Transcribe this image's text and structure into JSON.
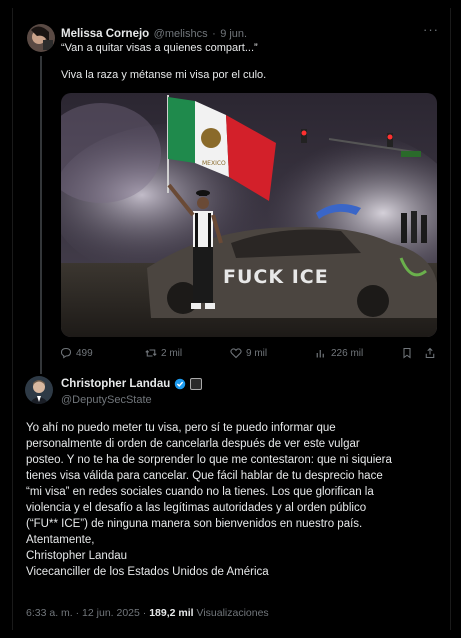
{
  "reply_tweet": {
    "author_name": "Melissa Cornejo",
    "handle": "@melishcs",
    "separator": "·",
    "date": "9 jun.",
    "line1": "“Van a quitar visas a quienes compart...”",
    "line2": "Viva la raza y métanse mi visa por el culo.",
    "more_icon": "more-dots-icon",
    "image": {
      "flag_text": "MEXICO",
      "graffiti": "FUCK ICE"
    },
    "actions": {
      "replies": "499",
      "retweets": "2 mil",
      "likes": "9 mil",
      "views": "226 mil"
    }
  },
  "main_tweet": {
    "author_name": "Christopher Landau",
    "handle": "@DeputySecState",
    "verified_color": "#1d9bf0",
    "paragraphs": [
      "Yo ahí no puedo meter tu visa, pero sí te puedo informar que",
      "personalmente di orden de cancelarla después de ver este vulgar",
      "posteo. Y no te ha de sorprender lo que me contestaron: que ni siquiera",
      "tienes visa válida para cancelar. Que fácil hablar de tu desprecio hace",
      "“mi visa” en redes sociales cuando no la tienes. Los que glorifican la",
      "violencia y el desafío a las legítimas autoridades y al orden público",
      "(“FU** ICE”) de ninguna manera son bienvenidos en nuestro país.",
      "Atentamente,",
      "Christopher Landau",
      "Vicecanciller de los Estados Unidos de América"
    ],
    "footer": {
      "time": "6:33 a. m.",
      "sep": "·",
      "date": "12 jun. 2025",
      "sep2": "·",
      "views": "189,2 mil",
      "views_label": "Visualizaciones"
    }
  }
}
